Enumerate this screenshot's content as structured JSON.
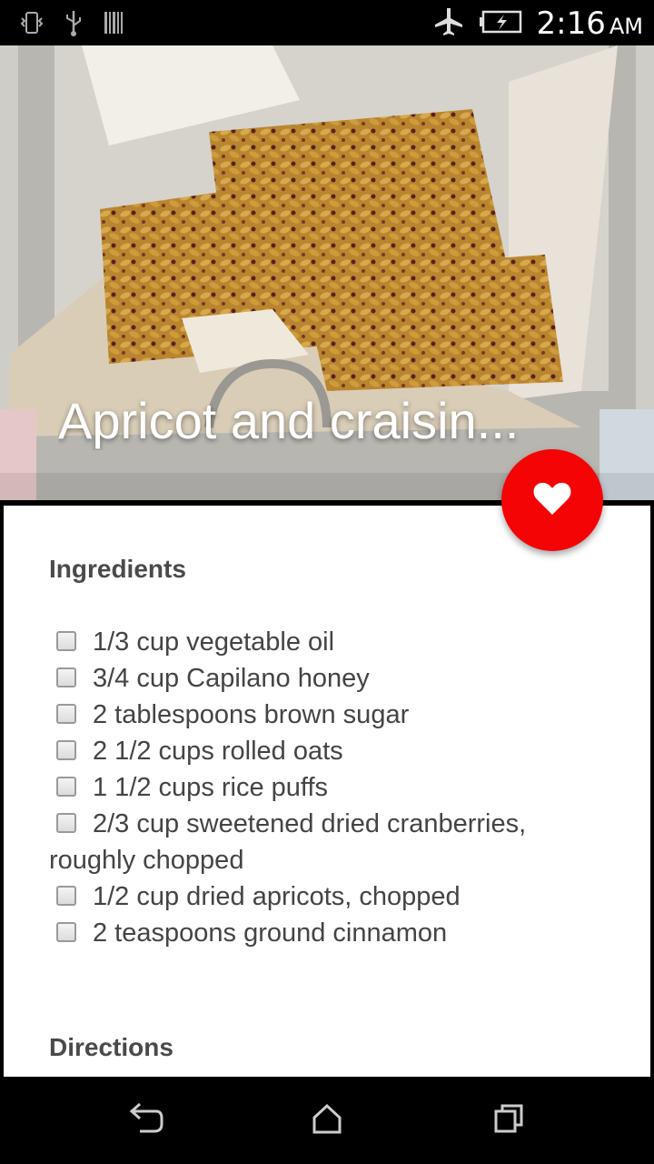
{
  "status_bar": {
    "time": "2:16",
    "ampm": "AM",
    "icons": [
      "vibrate-icon",
      "usb-icon",
      "barcode-icon",
      "airplane-mode-icon",
      "battery-charging-icon"
    ]
  },
  "recipe": {
    "title": "Apricot and craisin..."
  },
  "fab": {
    "icon": "heart-icon",
    "color": "#f40404"
  },
  "ingredients": {
    "heading": "Ingredients",
    "items": [
      "1/3 cup vegetable oil",
      "3/4 cup Capilano honey",
      "2 tablespoons brown sugar",
      "2 1/2 cups rolled oats",
      "1 1/2 cups rice puffs",
      "2/3 cup sweetened dried cranberries, roughly chopped",
      "1/2 cup dried apricots, chopped",
      "2 teaspoons ground cinnamon"
    ]
  },
  "directions": {
    "heading": "Directions"
  },
  "nav_bar": {
    "icons": [
      "back-icon",
      "home-icon",
      "recents-icon"
    ]
  }
}
